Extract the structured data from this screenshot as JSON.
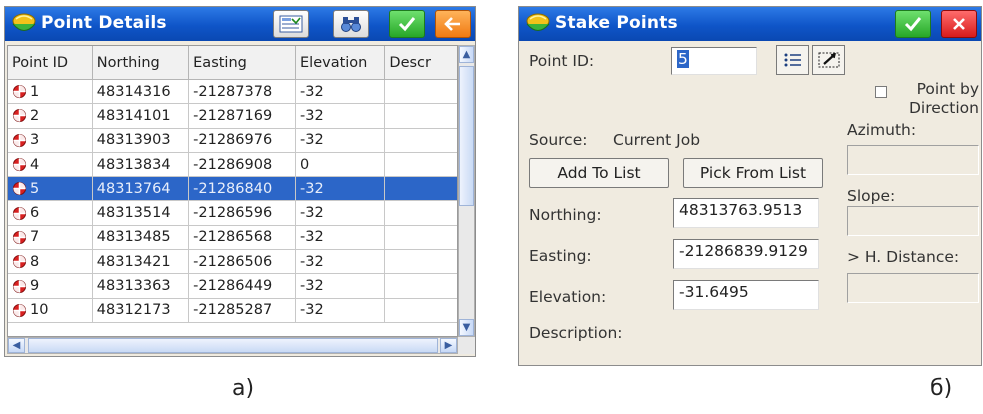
{
  "point_details": {
    "title": "Point Details",
    "columns": [
      "Point ID",
      "Northing",
      "Easting",
      "Elevation",
      "Descr"
    ],
    "rows": [
      {
        "id": "1",
        "northing": "48314316",
        "easting": "-21287378",
        "elevation": "-32",
        "descr": ""
      },
      {
        "id": "2",
        "northing": "48314101",
        "easting": "-21287169",
        "elevation": "-32",
        "descr": ""
      },
      {
        "id": "3",
        "northing": "48313903",
        "easting": "-21286976",
        "elevation": "-32",
        "descr": ""
      },
      {
        "id": "4",
        "northing": "48313834",
        "easting": "-21286908",
        "elevation": "0",
        "descr": ""
      },
      {
        "id": "5",
        "northing": "48313764",
        "easting": "-21286840",
        "elevation": "-32",
        "descr": ""
      },
      {
        "id": "6",
        "northing": "48313514",
        "easting": "-21286596",
        "elevation": "-32",
        "descr": ""
      },
      {
        "id": "7",
        "northing": "48313485",
        "easting": "-21286568",
        "elevation": "-32",
        "descr": ""
      },
      {
        "id": "8",
        "northing": "48313421",
        "easting": "-21286506",
        "elevation": "-32",
        "descr": ""
      },
      {
        "id": "9",
        "northing": "48313363",
        "easting": "-21286449",
        "elevation": "-32",
        "descr": ""
      },
      {
        "id": "10",
        "northing": "48312173",
        "easting": "-21285287",
        "elevation": "-32",
        "descr": ""
      }
    ],
    "selected_row": "5",
    "caption": "а)"
  },
  "stake_points": {
    "title": "Stake Points",
    "point_id_label": "Point ID:",
    "point_id_value": "5",
    "point_by_direction_label": "Point by Direction",
    "azimuth_label": "Azimuth:",
    "source_label": "Source:",
    "source_value": "Current Job",
    "add_to_list": "Add To List",
    "pick_from_list": "Pick From List",
    "slope_label": "Slope:",
    "northing_label": "Northing:",
    "northing_value": "48313763.9513",
    "easting_label": "Easting:",
    "easting_value": "-21286839.9129",
    "h_distance_label": "> H. Distance:",
    "elevation_label": "Elevation:",
    "elevation_value": "-31.6495",
    "description_label": "Description:",
    "caption": "б)"
  },
  "colors": {
    "title_blue": "#0f55c8",
    "selection_blue": "#2c66c8",
    "point_icon_red": "#d82020"
  }
}
